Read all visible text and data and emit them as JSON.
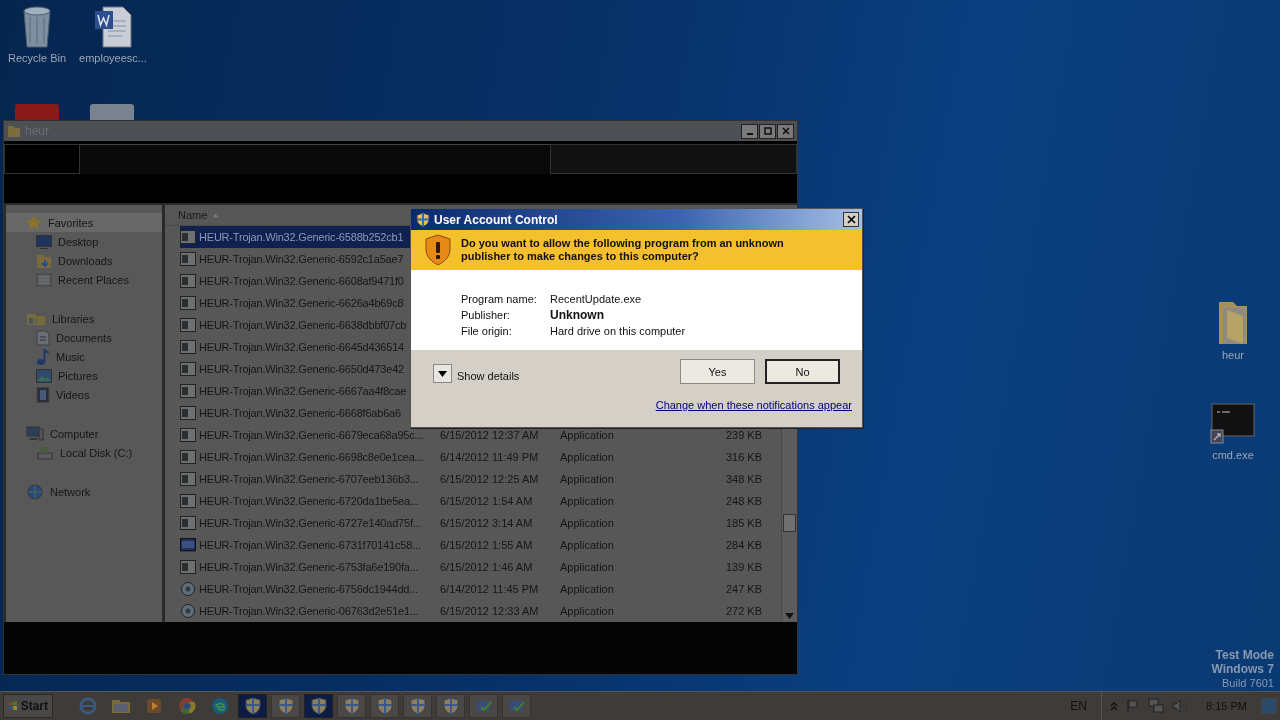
{
  "desktop": {
    "icons": [
      {
        "label": "Recycle Bin",
        "kind": "recycle"
      },
      {
        "label": "employeesc...",
        "kind": "document"
      },
      {
        "label": "heur",
        "kind": "folder"
      },
      {
        "label": "cmd.exe",
        "kind": "console"
      }
    ],
    "os_notice": [
      "Test Mode",
      "Windows 7",
      "Build 7601"
    ]
  },
  "explorer": {
    "title": "heur",
    "navigation": [
      {
        "label": "Favorites",
        "kind": "star",
        "selected": true,
        "children": [
          {
            "label": "Desktop",
            "kind": "desktop",
            "selected": false
          },
          {
            "label": "Downloads",
            "kind": "downloads",
            "selected": false
          },
          {
            "label": "Recent Places",
            "kind": "recent",
            "selected": false
          }
        ]
      },
      {
        "label": "Libraries",
        "kind": "library",
        "selected": false,
        "children": [
          {
            "label": "Documents",
            "kind": "documents",
            "selected": false
          },
          {
            "label": "Music",
            "kind": "music",
            "selected": false
          },
          {
            "label": "Pictures",
            "kind": "pictures",
            "selected": false
          },
          {
            "label": "Videos",
            "kind": "videos",
            "selected": false
          }
        ]
      },
      {
        "label": "Computer",
        "kind": "computer",
        "selected": false,
        "children": [
          {
            "label": "Local Disk (C:)",
            "kind": "disk",
            "selected": false
          }
        ]
      },
      {
        "label": "Network",
        "kind": "network",
        "selected": false
      }
    ],
    "columns": [
      "Name"
    ],
    "rows": [
      {
        "name": "HEUR-Trojan.Win32.Generic-6588b252cb1",
        "kind": "app",
        "selected": true
      },
      {
        "name": "HEUR-Trojan.Win32.Generic-6592c1a5ae7",
        "kind": "app",
        "selected": false
      },
      {
        "name": "HEUR-Trojan.Win32.Generic-6608af9471f0",
        "kind": "app",
        "selected": false
      },
      {
        "name": "HEUR-Trojan.Win32.Generic-6626a4b69c8",
        "kind": "app",
        "selected": false
      },
      {
        "name": "HEUR-Trojan.Win32.Generic-6638dbbf07cb",
        "kind": "app",
        "selected": false
      },
      {
        "name": "HEUR-Trojan.Win32.Generic-6645d436514",
        "kind": "app",
        "selected": false
      },
      {
        "name": "HEUR-Trojan.Win32.Generic-6650d473e42",
        "kind": "app",
        "selected": false
      },
      {
        "name": "HEUR-Trojan.Win32.Generic-6667aa4f8cae",
        "kind": "app",
        "selected": false
      },
      {
        "name": "HEUR-Trojan.Win32.Generic-6668f6ab6a6",
        "kind": "app",
        "selected": false
      },
      {
        "name": "HEUR-Trojan.Win32.Generic-6679eca68a95c...",
        "date": "6/15/2012 12:37 AM",
        "type": "Application",
        "size": "239 KB",
        "kind": "app",
        "selected": false
      },
      {
        "name": "HEUR-Trojan.Win32.Generic-6698c8e0e1cea...",
        "date": "6/14/2012 11:49 PM",
        "type": "Application",
        "size": "316 KB",
        "kind": "app",
        "selected": false
      },
      {
        "name": "HEUR-Trojan.Win32.Generic-6707eeb136b3...",
        "date": "6/15/2012 12:25 AM",
        "type": "Application",
        "size": "348 KB",
        "kind": "app",
        "selected": false
      },
      {
        "name": "HEUR-Trojan.Win32.Generic-6720da1be5ea...",
        "date": "6/15/2012 1:54 AM",
        "type": "Application",
        "size": "248 KB",
        "kind": "app",
        "selected": false
      },
      {
        "name": "HEUR-Trojan.Win32.Generic-6727e140ad75f...",
        "date": "6/15/2012 3:14 AM",
        "type": "Application",
        "size": "185 KB",
        "kind": "app",
        "selected": false
      },
      {
        "name": "HEUR-Trojan.Win32.Generic-6731f70141c58...",
        "date": "6/15/2012 1:55 AM",
        "type": "Application",
        "size": "284 KB",
        "kind": "window",
        "selected": false
      },
      {
        "name": "HEUR-Trojan.Win32.Generic-6753fa6e190fa...",
        "date": "6/15/2012 1:46 AM",
        "type": "Application",
        "size": "139 KB",
        "kind": "app",
        "selected": false
      },
      {
        "name": "HEUR-Trojan.Win32.Generic-6756dc1944dd...",
        "date": "6/14/2012 11:45 PM",
        "type": "Application",
        "size": "247 KB",
        "kind": "setup",
        "selected": false
      },
      {
        "name": "HEUR-Trojan.Win32.Generic-06763d2e51e1...",
        "date": "6/15/2012 12:33 AM",
        "type": "Application",
        "size": "272 KB",
        "kind": "setup",
        "selected": false
      }
    ]
  },
  "uac": {
    "title": "User Account Control",
    "question": "Do you want to allow the following program from an unknown publisher to make changes to this computer?",
    "fields": [
      {
        "label": "Program name:",
        "value": "RecentUpdate.exe",
        "kind": "plain"
      },
      {
        "label": "Publisher:",
        "value": "Unknown",
        "kind": "emphasis"
      },
      {
        "label": "File origin:",
        "value": "Hard drive on this computer",
        "kind": "plain"
      }
    ],
    "details": {
      "label": "Show details",
      "expanded": false
    },
    "buttons": [
      {
        "label": "Yes",
        "default": false
      },
      {
        "label": "No",
        "default": true
      }
    ],
    "link": "Change when these notifications appear"
  },
  "taskbar": {
    "start": "Start",
    "apps": [
      {
        "kind": "ie",
        "selected": false
      },
      {
        "kind": "explorer",
        "selected": false
      },
      {
        "kind": "media",
        "selected": false
      },
      {
        "kind": "chrome",
        "selected": false
      },
      {
        "kind": "edge",
        "selected": false
      },
      {
        "kind": "shield",
        "selected": true
      },
      {
        "kind": "shield",
        "selected": false
      },
      {
        "kind": "shield",
        "selected": true
      },
      {
        "kind": "shield",
        "selected": false
      },
      {
        "kind": "shield",
        "selected": false
      },
      {
        "kind": "shield",
        "selected": false
      },
      {
        "kind": "shield",
        "selected": false
      },
      {
        "kind": "setup",
        "selected": false
      },
      {
        "kind": "setup",
        "selected": false
      }
    ],
    "language": "EN",
    "clock": "8:15 PM"
  }
}
